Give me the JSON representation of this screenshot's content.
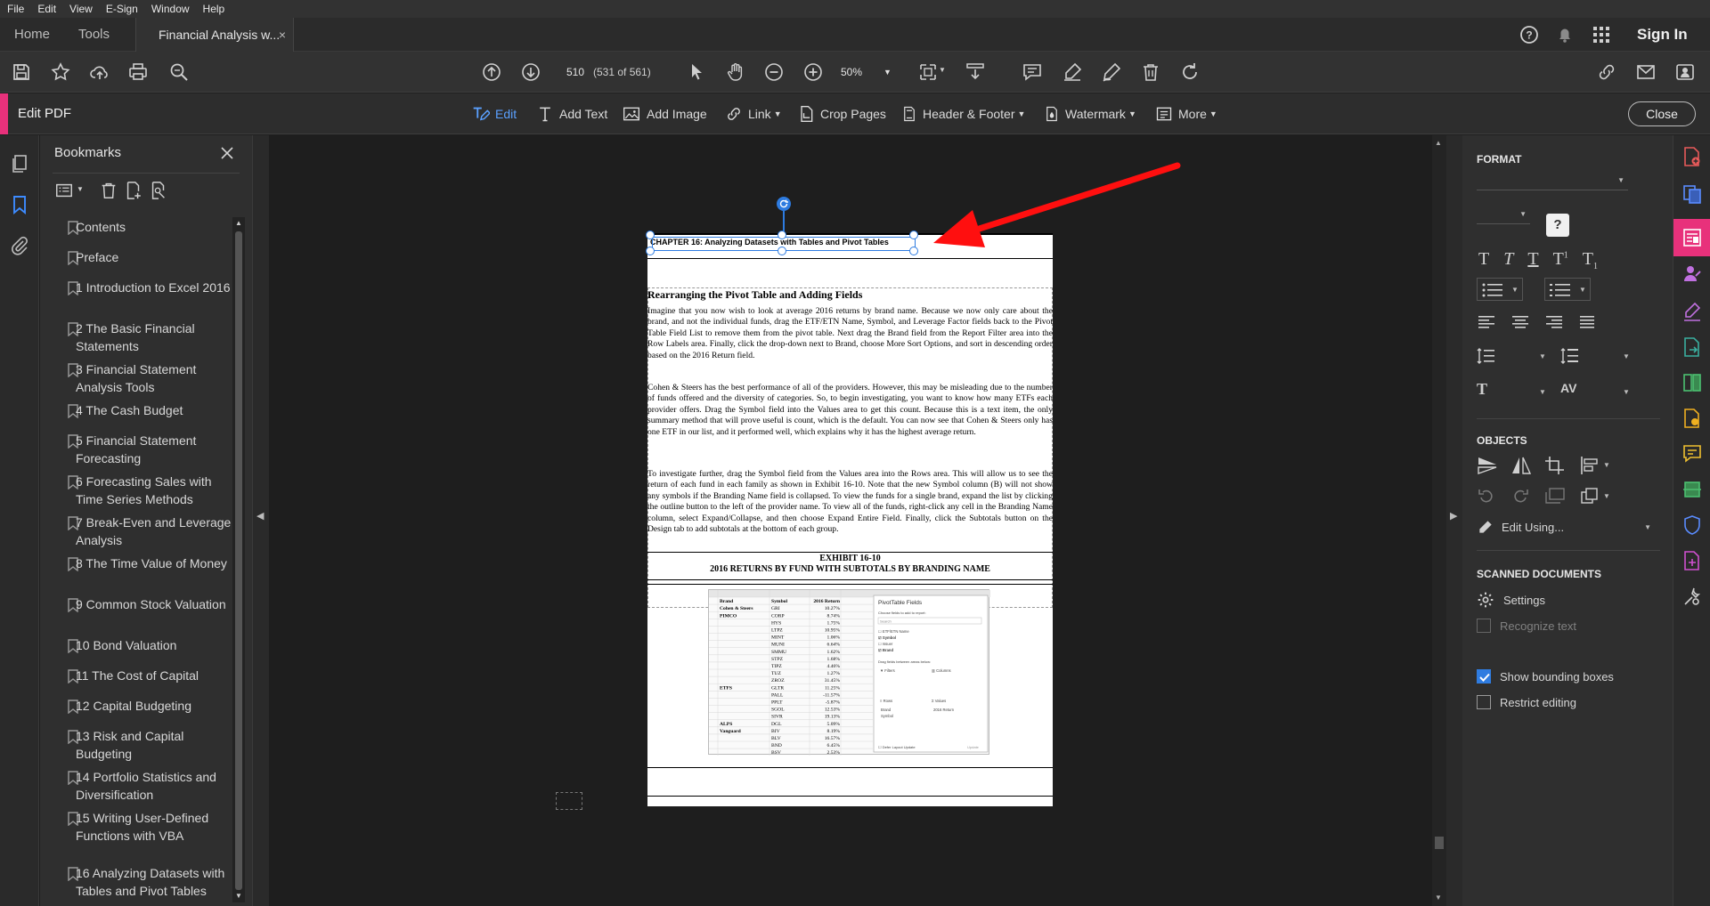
{
  "menubar": {
    "items": [
      "File",
      "Edit",
      "View",
      "E-Sign",
      "Window",
      "Help"
    ]
  },
  "tabs": {
    "home": "Home",
    "tools": "Tools",
    "document": "Financial Analysis w...",
    "close": "×"
  },
  "account": {
    "sign_in": "Sign In"
  },
  "toolbar": {
    "page_number": "510",
    "page_of": "(531 of 561)",
    "zoom": "50%"
  },
  "editbar": {
    "title": "Edit PDF",
    "items": [
      "Edit",
      "Add Text",
      "Add Image",
      "Link",
      "Crop Pages",
      "Header & Footer",
      "Watermark",
      "More"
    ],
    "close": "Close"
  },
  "bookmarks": {
    "title": "Bookmarks",
    "items": [
      "Contents",
      "Preface",
      "1 Introduction to Excel 2016",
      "2 The Basic Financial Statements",
      "3 Financial Statement Analysis Tools",
      "4 The Cash Budget",
      "5 Financial Statement Forecasting",
      "6 Forecasting Sales with Time Series Methods",
      "7 Break-Even and Leverage Analysis",
      "8 The Time Value of Money",
      "9 Common Stock Valuation",
      "10 Bond Valuation",
      "11 The Cost of Capital",
      "12 Capital Budgeting",
      "13 Risk and Capital Budgeting",
      "14 Portfolio Statistics and Diversification",
      "15 Writing User-Defined Functions with VBA",
      "16 Analyzing Datasets with Tables and Pivot Tables"
    ]
  },
  "document": {
    "header": "CHAPTER 16: Analyzing Datasets with Tables and Pivot Tables",
    "section_title": "Rearranging the Pivot Table and Adding Fields",
    "paragraphs": [
      "Imagine that you now wish to look at average 2016 returns by brand name. Because we now only care about the brand, and not the individual funds, drag the ETF/ETN Name, Symbol, and Leverage Factor fields back to the Pivot Table Field List to remove them from the pivot table. Next drag the Brand field from the Report Filter area into the Row Labels area. Finally, click the drop-down next to Brand, choose More Sort Options, and sort in descending order based on the 2016 Return field.",
      "Cohen & Steers has the best performance of all of the providers. However, this may be misleading due to the number of funds offered and the diversity of categories. So, to begin investigating, you want to know how many ETFs each provider offers. Drag the Symbol field into the Values area to get this count. Because this is a text item, the only summary method that will prove useful is count, which is the default. You can now see that Cohen & Steers only has one ETF in our list, and it performed well, which explains why it has the highest average return.",
      "To investigate further, drag the Symbol field from the Values area into the Rows area. This will allow us to see the return of each fund in each family as shown in Exhibit 16-10. Note that the new Symbol column (B) will not show any symbols if the Branding Name field is collapsed. To view the funds for a single brand, expand the list by clicking the outline button to the left of the provider name. To view all of the funds, right-click any cell in the Branding Name column, select Expand/Collapse, and then choose Expand Entire Field. Finally, click the Subtotals button on the Design tab to add subtotals at the bottom of each group."
    ],
    "exhibit_label": "EXHIBIT 16-10",
    "exhibit_caption": "2016 RETURNS BY FUND WITH SUBTOTALS BY BRANDING NAME",
    "exhibit_table": {
      "headers": [
        "Brand",
        "Symbol",
        "2016 Return"
      ],
      "rows": [
        [
          "Cohen & Steers",
          "GRI",
          "10.27%"
        ],
        [
          "PIMCO",
          "CORP",
          "8.74%"
        ],
        [
          "",
          "HYS",
          "1.75%"
        ],
        [
          "",
          "LTPZ",
          "10.95%"
        ],
        [
          "",
          "MINT",
          "1.06%"
        ],
        [
          "",
          "MUNI",
          "6.64%"
        ],
        [
          "",
          "SMMU",
          "1.62%"
        ],
        [
          "",
          "STPZ",
          "1.68%"
        ],
        [
          "",
          "TIPZ",
          "4.46%"
        ],
        [
          "",
          "TUZ",
          "1.27%"
        ],
        [
          "",
          "ZROZ",
          "31.45%"
        ],
        [
          "ETFS",
          "GLTR",
          "11.25%"
        ],
        [
          "",
          "PALL",
          "-11.57%"
        ],
        [
          "",
          "PPLT",
          "-5.87%"
        ],
        [
          "",
          "SGOL",
          "12.53%"
        ],
        [
          "",
          "SIVR",
          "19.13%"
        ],
        [
          "ALPS",
          "DGL",
          "5.09%"
        ],
        [
          "Vanguard",
          "BIV",
          "8.19%"
        ],
        [
          "",
          "BLV",
          "16.57%"
        ],
        [
          "",
          "BND",
          "6.45%"
        ],
        [
          "",
          "BSV",
          "2.53%"
        ]
      ],
      "field_panel_title": "PivotTable Fields",
      "field_panel_subtitle": "Choose fields to add to report:",
      "field_panel_search": "Search",
      "fields": [
        "ETF/ETN Name",
        "Symbol",
        "Issuer",
        "Brand"
      ],
      "areas_label": "Drag fields between areas below:",
      "areas": [
        "Filters",
        "Columns",
        "Rows",
        "Values"
      ],
      "rows_area": [
        "Brand",
        "Symbol"
      ],
      "values_area": [
        "2016 Return"
      ],
      "defer_label": "Defer Layout Update",
      "update_button": "Update"
    }
  },
  "format_panel": {
    "format_title": "FORMAT",
    "objects_title": "OBJECTS",
    "edit_using": "Edit Using...",
    "scanned_title": "SCANNED DOCUMENTS",
    "settings": "Settings",
    "recognize": "Recognize text",
    "show_bounding": "Show bounding boxes",
    "restrict": "Restrict editing"
  },
  "colors": {
    "accent": "#2f7ce0",
    "edit_pink": "#e8317b",
    "annotation_red": "#ff0f0f"
  }
}
